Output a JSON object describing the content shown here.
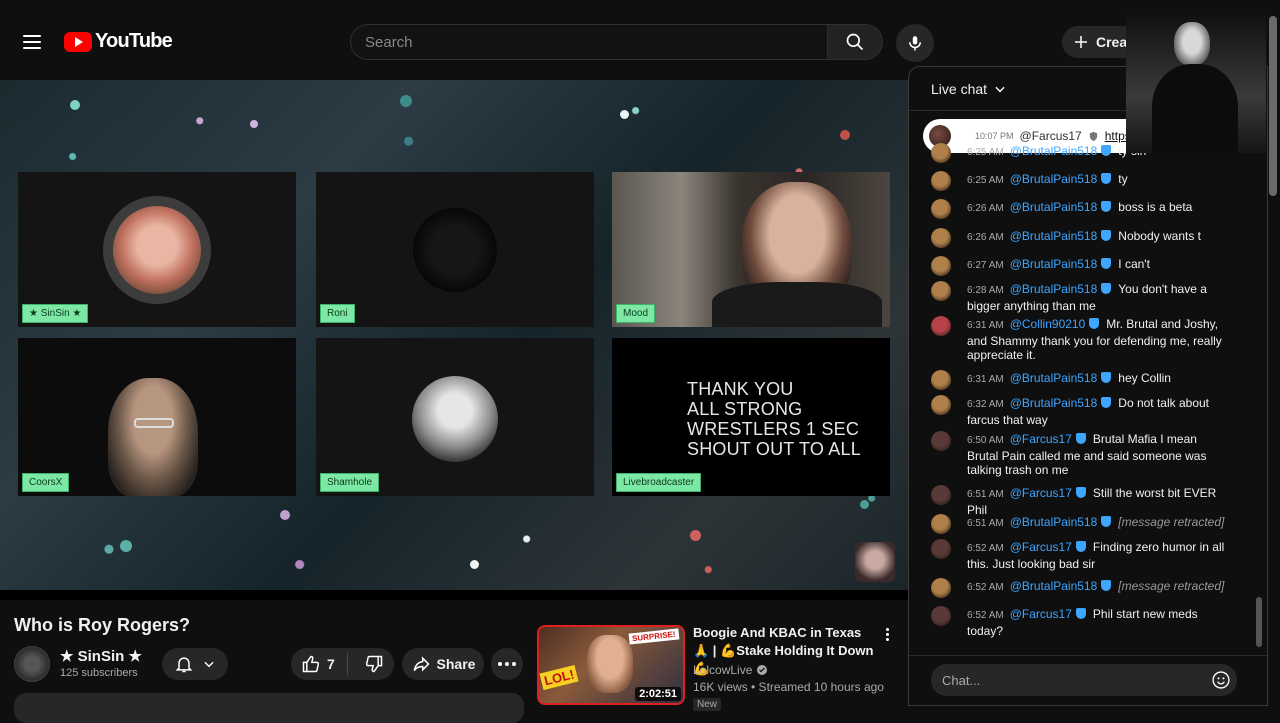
{
  "header": {
    "logo_text": "YouTube",
    "search_placeholder": "Search",
    "create_label": "Create"
  },
  "player": {
    "tiles": [
      {
        "label": "★ SinSin ★"
      },
      {
        "label": "Roni"
      },
      {
        "label": "Mood"
      },
      {
        "label": "CoorsX"
      },
      {
        "label": "Shamhole"
      },
      {
        "label": "Livebroadcaster"
      }
    ],
    "promo_text": [
      "THANK YOU",
      "ALL STRONG",
      "WRESTLERS 1 SEC",
      "SHOUT OUT TO ALL"
    ]
  },
  "video": {
    "title": "Who is Roy Rogers?",
    "channel_name": "★ SinSin ★",
    "subscribers": "125 subscribers",
    "like_count": "7",
    "share_label": "Share"
  },
  "recommendation": {
    "title": "Boogie And KBAC in Texas🙏 | 💪Stake Holding It Down💪",
    "channel": "LolcowLive",
    "meta": "16K views • Streamed 10 hours ago",
    "duration": "2:02:51",
    "badge": "New"
  },
  "chat": {
    "header_title": "Live chat",
    "pinned": {
      "time": "10:07 PM",
      "author": "@Farcus17",
      "text": "https://"
    },
    "messages": [
      {
        "time": "6:25 AM",
        "author": "@BrutalPain518",
        "text": "ty sin",
        "avatar": "#b0804a"
      },
      {
        "time": "6:25 AM",
        "author": "@BrutalPain518",
        "text": "ty",
        "avatar": "#b0804a"
      },
      {
        "time": "6:26 AM",
        "author": "@BrutalPain518",
        "text": "boss is a beta",
        "avatar": "#b0804a"
      },
      {
        "time": "6:26 AM",
        "author": "@BrutalPain518",
        "text": "Nobody wants t",
        "avatar": "#b0804a"
      },
      {
        "time": "6:27 AM",
        "author": "@BrutalPain518",
        "text": "I can't",
        "avatar": "#b0804a"
      },
      {
        "time": "6:28 AM",
        "author": "@BrutalPain518",
        "text": "You don't have a bigger anything than me",
        "avatar": "#b0804a"
      },
      {
        "time": "6:31 AM",
        "author": "@Collin90210",
        "text": "Mr. Brutal and Joshy, and Shammy thank you for defending me, really appreciate it.",
        "avatar": "#b8424a"
      },
      {
        "time": "6:31 AM",
        "author": "@BrutalPain518",
        "text": "hey Collin",
        "avatar": "#b0804a"
      },
      {
        "time": "6:32 AM",
        "author": "@BrutalPain518",
        "text": "Do not talk about farcus that way",
        "avatar": "#b0804a"
      },
      {
        "time": "6:50 AM",
        "author": "@Farcus17",
        "text": "Brutal Mafia I mean Brutal Pain called me and said someone was talking trash on me",
        "avatar": "#5a3a36"
      },
      {
        "time": "6:51 AM",
        "author": "@Farcus17",
        "text": "Still the worst bit EVER Phil",
        "avatar": "#5a3a36"
      },
      {
        "time": "6:51 AM",
        "author": "@BrutalPain518",
        "text": "[message retracted]",
        "avatar": "#b0804a",
        "retracted": true
      },
      {
        "time": "6:52 AM",
        "author": "@Farcus17",
        "text": "Finding zero humor in all this. Just looking bad sir",
        "avatar": "#5a3a36"
      },
      {
        "time": "6:52 AM",
        "author": "@BrutalPain518",
        "text": "[message retracted]",
        "avatar": "#b0804a",
        "retracted": true
      },
      {
        "time": "6:52 AM",
        "author": "@Farcus17",
        "text": "Phil start new meds today?",
        "avatar": "#5a3a36"
      }
    ],
    "input_placeholder": "Chat..."
  },
  "colors": {
    "accent_blue": "#3ea6ff",
    "brand_red": "#ff0000",
    "tile_label_bg": "#7de8a5"
  },
  "icons": [
    "menu-icon",
    "search-icon",
    "mic-icon",
    "plus-icon",
    "bell-icon",
    "chevron-down-icon",
    "like-icon",
    "dislike-icon",
    "share-icon",
    "more-icon",
    "emoji-icon",
    "verified-icon"
  ]
}
